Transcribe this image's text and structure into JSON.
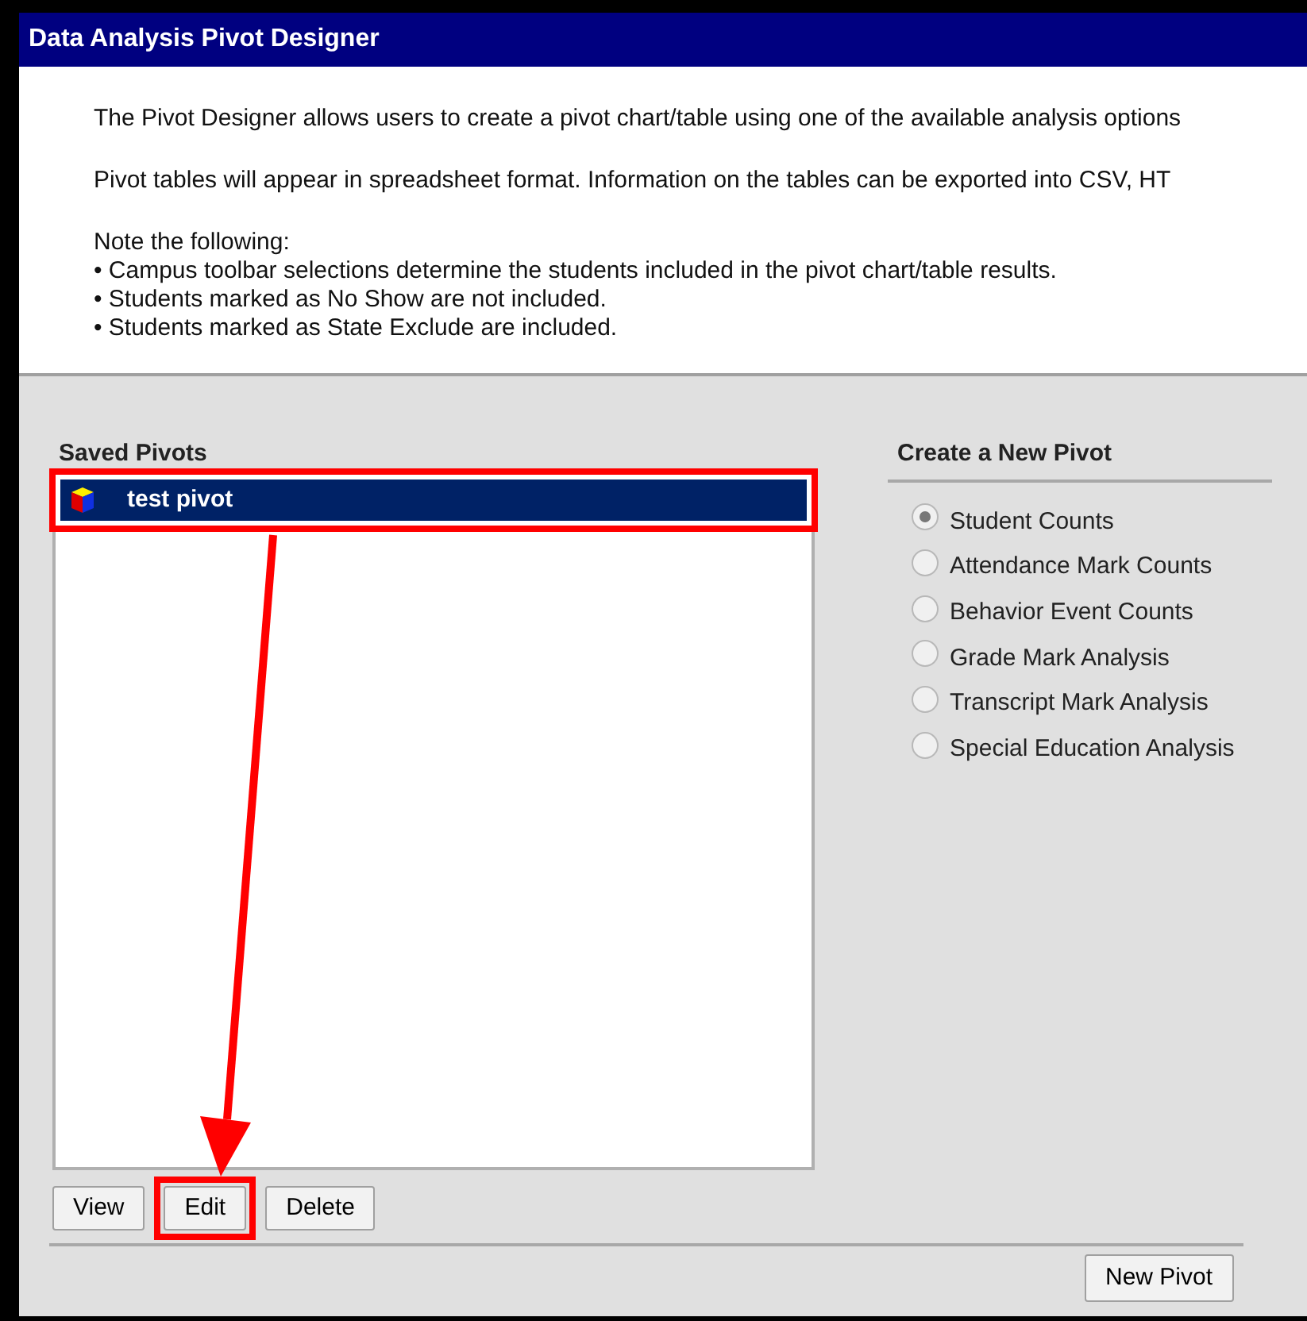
{
  "window": {
    "title": "Data Analysis Pivot Designer"
  },
  "intro": {
    "paragraphs": [
      "The Pivot Designer allows users to create a pivot chart/table using one of the available analysis options",
      "Pivot tables will appear in spreadsheet format. Information on the tables can be exported into CSV, HT"
    ],
    "note_heading": "Note the following:",
    "bullets": [
      "• Campus toolbar selections determine the students included in the pivot chart/table results.",
      "• Students marked as No Show are not included.",
      "• Students marked as State Exclude are included."
    ]
  },
  "saved_pivots": {
    "heading": "Saved Pivots",
    "items": [
      {
        "label": "test pivot",
        "selected": true,
        "highlighted": true
      }
    ],
    "buttons": [
      {
        "label": "View",
        "highlighted": false
      },
      {
        "label": "Edit",
        "highlighted": true
      },
      {
        "label": "Delete",
        "highlighted": false
      }
    ]
  },
  "new_pivot": {
    "heading": "Create a New Pivot",
    "options": [
      {
        "label": "Student Counts",
        "selected": true
      },
      {
        "label": "Attendance Mark Counts",
        "selected": false
      },
      {
        "label": "Behavior Event Counts",
        "selected": false
      },
      {
        "label": "Grade Mark Analysis",
        "selected": false
      },
      {
        "label": "Transcript Mark Analysis",
        "selected": false
      },
      {
        "label": "Special Education Analysis",
        "selected": false
      }
    ]
  },
  "footer_button": "New Pivot"
}
